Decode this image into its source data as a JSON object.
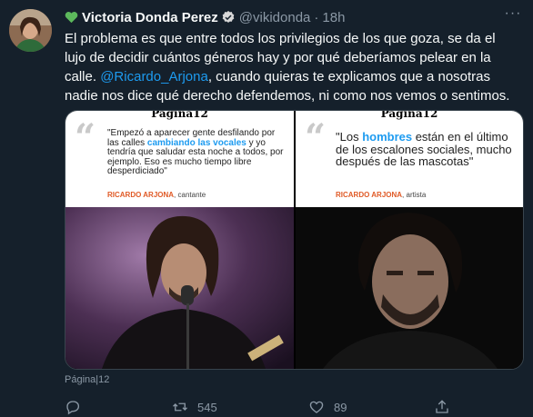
{
  "tweet": {
    "author_name": "Victoria Donda Perez",
    "handle": "@vikidonda",
    "separator": "·",
    "time": "18h",
    "text_before": "El problema es que entre todos los privilegios de los que goza, se da el lujo de decidir cuántos géneros hay y por qué deberíamos pelear en la calle.",
    "mention": "@Ricardo_Arjona",
    "text_after": ", cuando quieras te explicamos que a nosotras nadie nos dice qué derecho defendemos, ni como nos vemos o sentimos.",
    "more_label": "···"
  },
  "media": {
    "left": {
      "logo": "Página12",
      "quote_part1": "\"Empezó a aparecer gente desfilando por las calles ",
      "quote_highlight": "cambiando las vocales",
      "quote_part2": " y yo tendría que saludar esta noche a todos, por ejemplo. Eso es mucho tiempo libre desperdiciado\"",
      "author_name": "RICARDO ARJONA",
      "author_role": ", cantante"
    },
    "right": {
      "logo": "Página12",
      "quote_part1": "\"Los ",
      "quote_highlight": "hombres",
      "quote_part2": " están en el último de los escalones sociales, mucho después de las mascotas\"",
      "author_name": "RICARDO ARJONA",
      "author_role": ", artista"
    }
  },
  "source_label": "Página|12",
  "actions": {
    "retweets": "545",
    "likes": "89"
  },
  "colors": {
    "background": "#15202b",
    "accent": "#1d9bf0",
    "muted": "#8b98a5",
    "heart_emoji": "#5cb85c"
  }
}
